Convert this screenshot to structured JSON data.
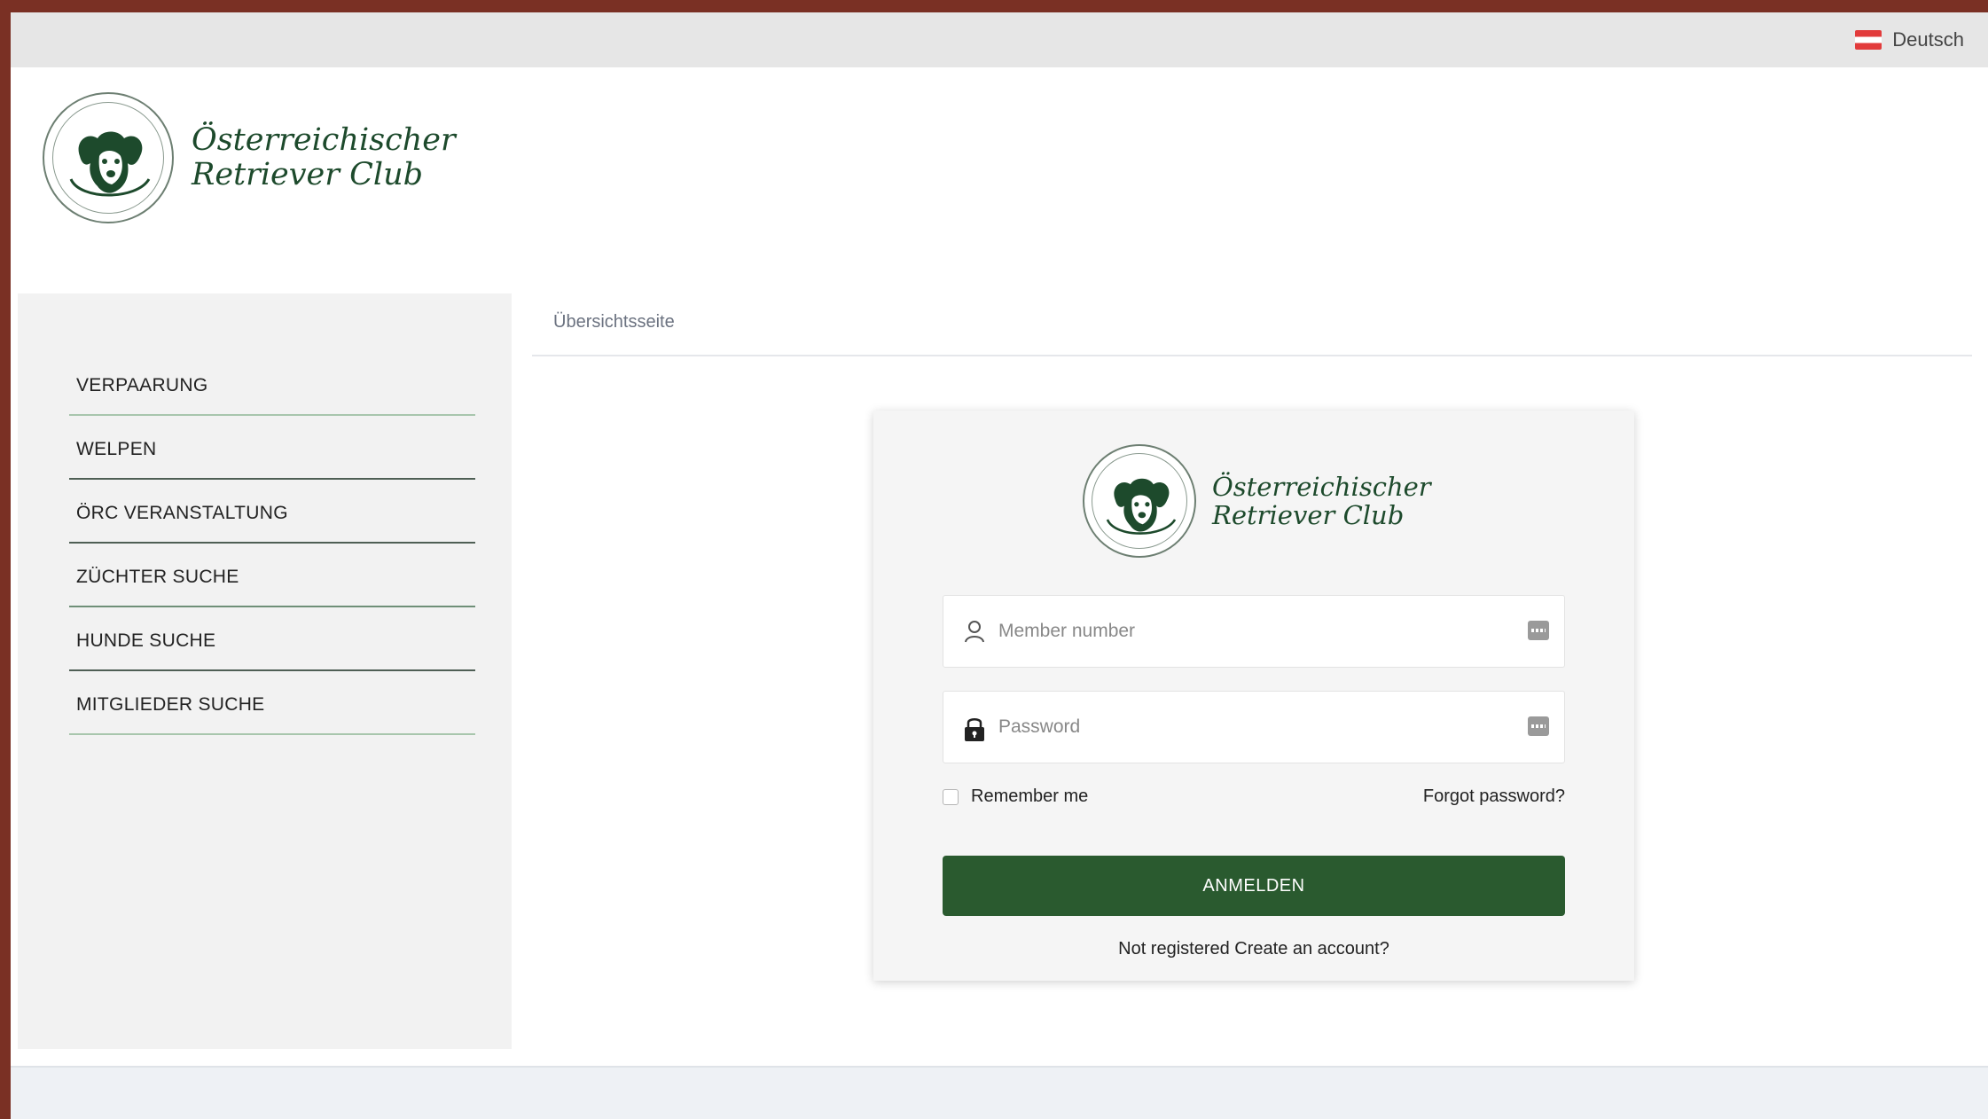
{
  "topbar": {
    "language": "Deutsch"
  },
  "brand": {
    "line1": "Österreichischer",
    "line2": "Retriever Club"
  },
  "sidebar": {
    "items": [
      {
        "label": "VERPAARUNG"
      },
      {
        "label": "WELPEN"
      },
      {
        "label": "ÖRC VERANSTALTUNG"
      },
      {
        "label": "ZÜCHTER SUCHE"
      },
      {
        "label": "HUNDE SUCHE"
      },
      {
        "label": "MITGLIEDER SUCHE"
      }
    ]
  },
  "breadcrumb": {
    "label": "Übersichtsseite"
  },
  "login": {
    "member_placeholder": "Member number",
    "password_placeholder": "Password",
    "remember_label": "Remember me",
    "forgot_label": "Forgot password?",
    "submit_label": "ANMELDEN",
    "register_label": "Not registered Create an account?"
  },
  "colors": {
    "brand_green": "#2a5a2f",
    "border_red": "#7a3024",
    "flag": "#e23b3b"
  }
}
